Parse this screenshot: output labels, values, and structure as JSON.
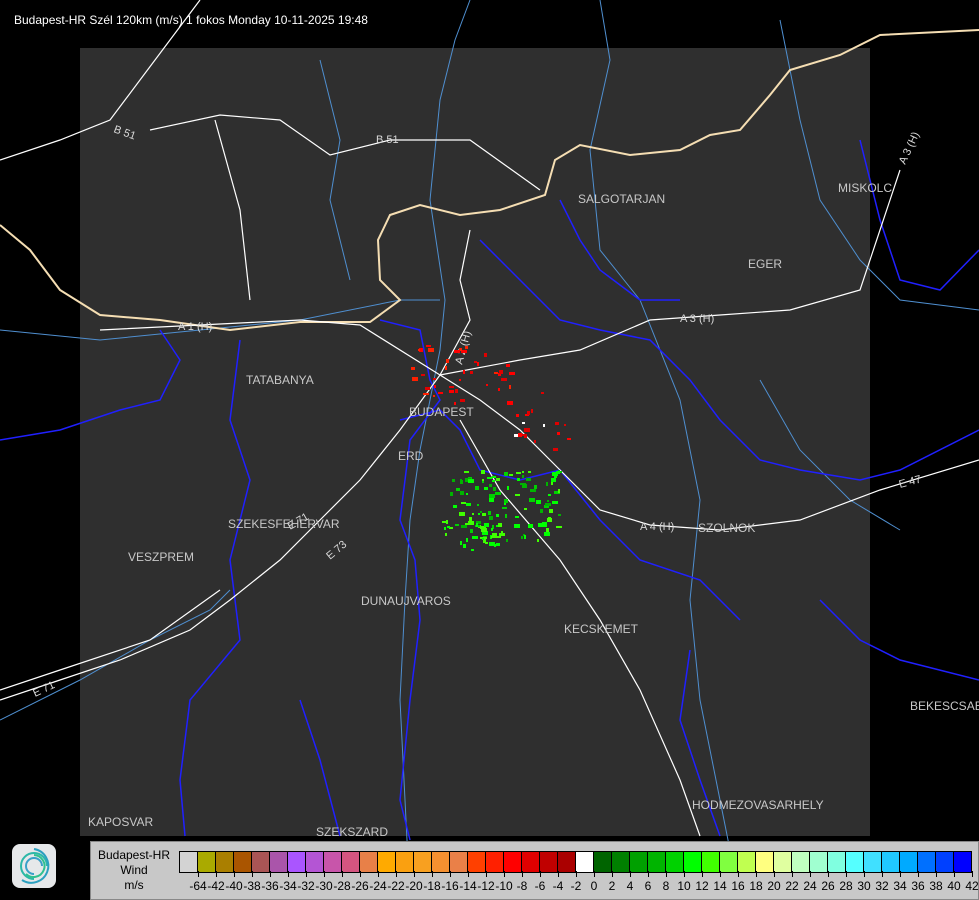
{
  "title": "Budapest-HR Szél 120km (m/s) 1 fokos Monday 10-11-2025 19:48",
  "map": {
    "cities": [
      "SALGOTARJAN",
      "MISKOLC",
      "EGER",
      "TATABANYA",
      "BUDAPEST",
      "ERD",
      "SZEKESFEHERVAR",
      "VESZPREM",
      "DUNAUJVAROS",
      "KECSKEMET",
      "SZOLNOK",
      "BEKESCSABA",
      "HODMEZOVASARHELY",
      "KAPOSVAR",
      "SZEKSZARD"
    ],
    "roads": [
      "B 51",
      "B 51",
      "A 1 (H)",
      "A 2 (H)",
      "A 3 (H)",
      "A 3 (H)",
      "A 4 (H)",
      "E 71",
      "E 73",
      "E 47",
      "E 71"
    ],
    "colors": {
      "background": "#000000",
      "radar_area": "#2f2f2f",
      "border": "#0000ff",
      "rivers": "#4f8fd0",
      "roads": "#ffffff",
      "country_border": "#f5deb3"
    }
  },
  "legend": {
    "title_lines": [
      "Budapest-HR",
      "Wind",
      "m/s"
    ],
    "tick_labels": [
      "-64",
      "-42",
      "-40",
      "-38",
      "-36",
      "-34",
      "-32",
      "-30",
      "-28",
      "-26",
      "-24",
      "-22",
      "-20",
      "-18",
      "-16",
      "-14",
      "-12",
      "-10",
      "-8",
      "-6",
      "-4",
      "-2",
      "0",
      "2",
      "4",
      "6",
      "8",
      "10",
      "12",
      "14",
      "16",
      "18",
      "20",
      "22",
      "24",
      "26",
      "28",
      "30",
      "32",
      "34",
      "36",
      "38",
      "40",
      "42"
    ],
    "colors": [
      "#d3d3d3",
      "#aaaa00",
      "#aa7f00",
      "#aa5500",
      "#aa5555",
      "#aa55aa",
      "#aa55ff",
      "#b455d4",
      "#c855aa",
      "#d45580",
      "#e88048",
      "#ffaa00",
      "#faa010",
      "#f8a020",
      "#f59030",
      "#ea8048",
      "#ff4000",
      "#ff2000",
      "#ff0000",
      "#e00000",
      "#c00000",
      "#aa0000",
      "#ffffff",
      "#006400",
      "#008000",
      "#00a000",
      "#00b400",
      "#00d200",
      "#00ff00",
      "#40ff00",
      "#80ff40",
      "#c0ff50",
      "#ffff80",
      "#e0ffa0",
      "#c0ffc0",
      "#a0ffd0",
      "#80ffe0",
      "#55ffff",
      "#40e0ff",
      "#20c8ff",
      "#00aaff",
      "#0070ff",
      "#0040ff",
      "#0000ff"
    ]
  },
  "logo": {
    "icon": "swirl-logo-icon"
  }
}
